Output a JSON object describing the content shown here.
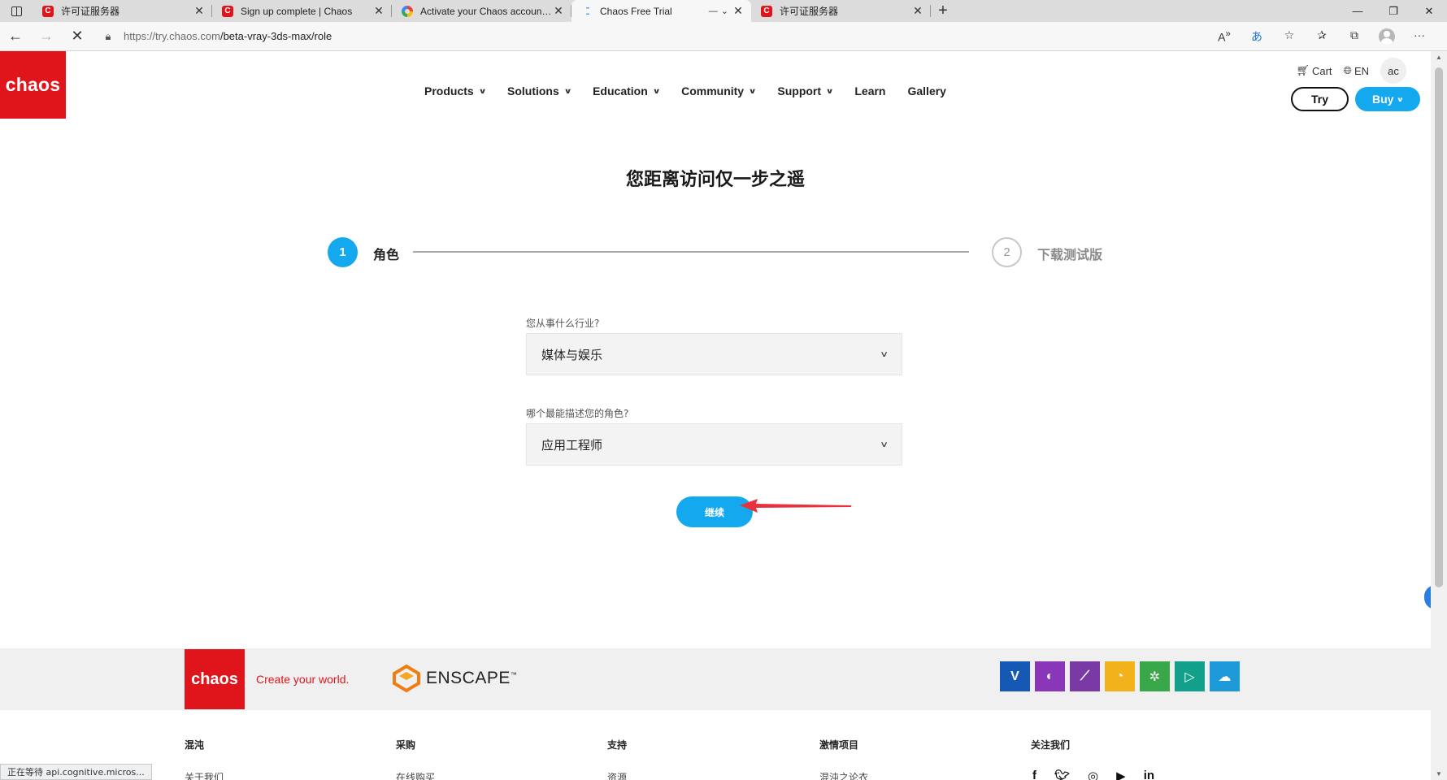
{
  "browser": {
    "tabs": [
      {
        "title": "许可证服务器",
        "favicon": "chaos-icon"
      },
      {
        "title": "Sign up complete | Chaos",
        "favicon": "chaos-icon"
      },
      {
        "title": "Activate your Chaos account - Ch",
        "favicon": "google-icon"
      },
      {
        "title": "Chaos Free Trial",
        "favicon": "loading-icon"
      },
      {
        "title": "许可证服务器",
        "favicon": "chaos-icon"
      }
    ],
    "url_host": "https://try.chaos.com",
    "url_path": "/beta-vray-3ds-max/role",
    "status_text": "正在等待 api.cognitive.micros..."
  },
  "header": {
    "logo_text": "chaos",
    "cart_label": "Cart",
    "lang_label": "EN",
    "avatar_initials": "ac",
    "nav": [
      "Products",
      "Solutions",
      "Education",
      "Community",
      "Support",
      "Learn",
      "Gallery"
    ],
    "try_label": "Try",
    "buy_label": "Buy"
  },
  "main": {
    "title": "您距离访问仅一步之遥",
    "step1_number": "1",
    "step1_label": "角色",
    "step2_number": "2",
    "step2_label": "下载测试版",
    "industry_label": "您从事什么行业?",
    "industry_value": "媒体与娱乐",
    "role_label": "哪个最能描述您的角色?",
    "role_value": "应用工程师",
    "continue_label": "继续"
  },
  "footer": {
    "logo_text": "chaos",
    "tagline": "Create your world.",
    "enscape_text": "ENSCAPE",
    "columns": [
      {
        "head": "混沌",
        "link": "关于我们"
      },
      {
        "head": "采购",
        "link": "在线购买"
      },
      {
        "head": "支持",
        "link": "资源"
      },
      {
        "head": "激情项目",
        "link": "混沌之论衣"
      },
      {
        "head": "关注我们",
        "link": ""
      }
    ]
  },
  "colors": {
    "brand_red": "#e0151b",
    "accent_blue": "#14a9ef"
  }
}
